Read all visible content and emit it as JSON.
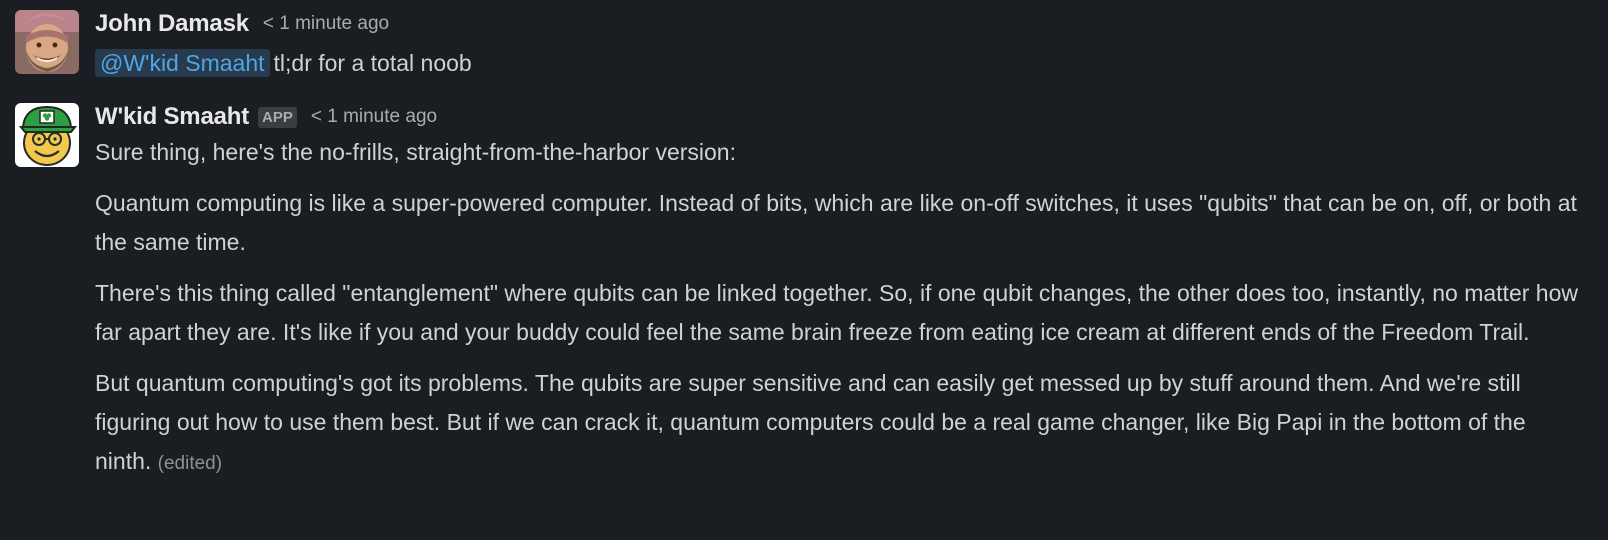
{
  "messages": [
    {
      "author": "John Damask",
      "timestamp": "< 1 minute ago",
      "mention": "@W'kid Smaaht",
      "text": "tl;dr for a total noob"
    },
    {
      "author": "W'kid Smaaht",
      "badge": "APP",
      "timestamp": "< 1 minute ago",
      "paragraphs": [
        "Sure thing, here's the no-frills, straight-from-the-harbor version:",
        "Quantum computing is like a super-powered computer. Instead of bits, which are like on-off switches, it uses \"qubits\" that can be on, off, or both at the same time.",
        "There's this thing called \"entanglement\" where qubits can be linked together. So, if one qubit changes, the other does too, instantly, no matter how far apart they are. It's like if you and your buddy could feel the same brain freeze from eating ice cream at different ends of the Freedom Trail.",
        "But quantum computing's got its problems. The qubits are super sensitive and can easily get messed up by stuff around them. And we're still figuring out how to use them best. But if we can crack it, quantum computers could be a real game changer, like Big Papi in the bottom of the ninth."
      ],
      "edited_label": "(edited)"
    }
  ],
  "colors": {
    "background": "#1a1d21",
    "text": "#d1d2d3",
    "mention_text": "#4fa6e4",
    "mention_bg": "#283b4e"
  }
}
